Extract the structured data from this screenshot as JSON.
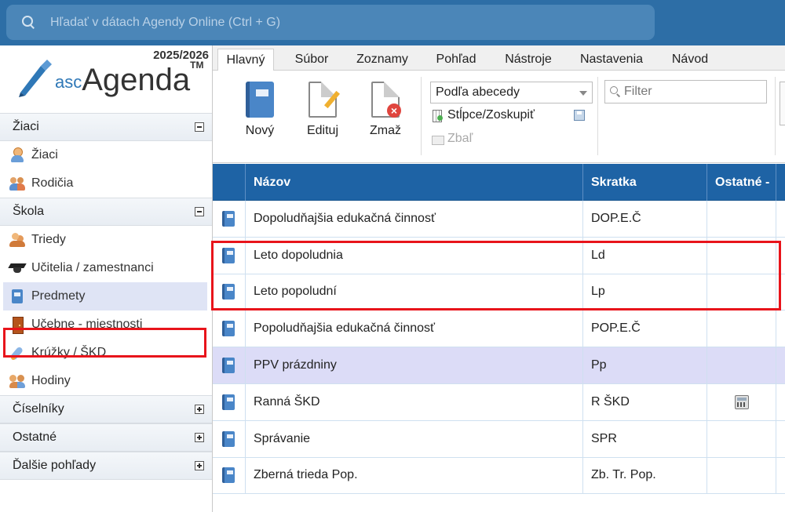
{
  "search": {
    "placeholder": "Hľadať v dátach Agendy Online (Ctrl + G)"
  },
  "brand": {
    "year": "2025/2026",
    "logo_prefix": "asc",
    "logo_name": "Agenda",
    "logo_tm": "TM"
  },
  "sidebar": {
    "sections": [
      {
        "label": "Žiaci",
        "expanded": true,
        "items": [
          {
            "label": "Žiaci",
            "icon": "person-icon"
          },
          {
            "label": "Rodičia",
            "icon": "parents-icon"
          }
        ]
      },
      {
        "label": "Škola",
        "expanded": true,
        "items": [
          {
            "label": "Triedy",
            "icon": "class-icon"
          },
          {
            "label": "Učitelia / zamestnanci",
            "icon": "graduation-cap-icon"
          },
          {
            "label": "Predmety",
            "icon": "book-icon",
            "active": true
          },
          {
            "label": "Učebne - miestnosti",
            "icon": "door-icon"
          },
          {
            "label": "Krúžky / ŠKD",
            "icon": "rocket-icon"
          },
          {
            "label": "Hodiny",
            "icon": "people-icon"
          }
        ]
      },
      {
        "label": "Číselníky",
        "expanded": false
      },
      {
        "label": "Ostatné",
        "expanded": false
      },
      {
        "label": "Ďalšie pohľady",
        "expanded": false
      }
    ]
  },
  "tabs": [
    "Hlavný",
    "Súbor",
    "Zoznamy",
    "Pohľad",
    "Nástroje",
    "Nastavenia",
    "Návod"
  ],
  "ribbon": {
    "new_label": "Nový",
    "edit_label": "Edituj",
    "delete_label": "Zmaž",
    "sort_value": "Podľa abecedy",
    "columns_label": "Stĺpce/Zoskupiť",
    "collapse_label": "Zbaľ",
    "filter_placeholder": "Filter"
  },
  "table": {
    "headers": {
      "name": "Názov",
      "short": "Skratka",
      "other": "Ostatné -"
    },
    "rows": [
      {
        "name": "Dopoludňajšia edukačná činnosť",
        "short": "DOP.E.Č",
        "other_icon": ""
      },
      {
        "name": "Leto dopoludnia",
        "short": "Ld",
        "other_icon": ""
      },
      {
        "name": "Leto popoludní",
        "short": "Lp",
        "other_icon": ""
      },
      {
        "name": "Popoludňajšia edukačná činnosť",
        "short": "POP.E.Č",
        "other_icon": ""
      },
      {
        "name": "PPV prázdniny",
        "short": "Pp",
        "other_icon": "",
        "selected": true
      },
      {
        "name": "Ranná ŠKD",
        "short": "R ŠKD",
        "other_icon": "calculator-icon"
      },
      {
        "name": "Správanie",
        "short": "SPR",
        "other_icon": ""
      },
      {
        "name": "Zberná trieda Pop.",
        "short": "Zb. Tr. Pop.",
        "other_icon": ""
      }
    ]
  },
  "colors": {
    "topbar": "#2d6ea6",
    "header": "#1e63a5",
    "selected_row": "#dcdcf7",
    "highlight": "#e8141b"
  }
}
